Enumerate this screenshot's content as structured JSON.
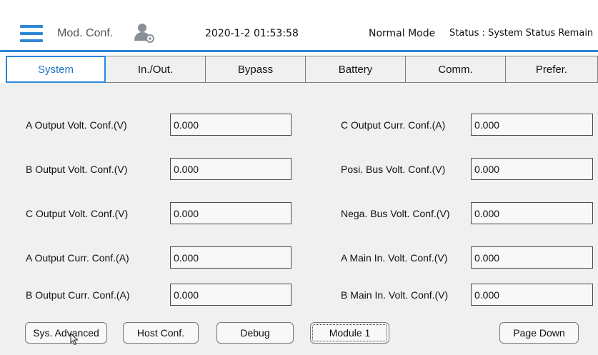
{
  "header": {
    "title": "Mod. Conf.",
    "datetime": "2020-1-2 01:53:58",
    "mode": "Normal Mode",
    "status": "Status : System Status Remain",
    "accent_color": "#2d86d6",
    "menu_icon": "hamburger-menu-icon",
    "user_icon": "user-settings-icon"
  },
  "tabs": [
    {
      "label": "System"
    },
    {
      "label": "In./Out."
    },
    {
      "label": "Bypass"
    },
    {
      "label": "Battery"
    },
    {
      "label": "Comm."
    },
    {
      "label": "Prefer."
    }
  ],
  "fields_left": [
    {
      "label": "A Output Volt. Conf.(V)",
      "value": "0.000"
    },
    {
      "label": "B Output Volt. Conf.(V)",
      "value": "0.000"
    },
    {
      "label": "C Output Volt. Conf.(V)",
      "value": "0.000"
    },
    {
      "label": "A Output Curr. Conf.(A)",
      "value": "0.000"
    },
    {
      "label": "B Output Curr. Conf.(A)",
      "value": "0.000"
    }
  ],
  "fields_right": [
    {
      "label": "C Output Curr. Conf.(A)",
      "value": "0.000"
    },
    {
      "label": "Posi. Bus Volt. Conf.(V)",
      "value": "0.000"
    },
    {
      "label": "Nega. Bus Volt. Conf.(V)",
      "value": "0.000"
    },
    {
      "label": "A Main In. Volt. Conf.(V)",
      "value": "0.000"
    },
    {
      "label": "B Main In. Volt. Conf.(V)",
      "value": "0.000"
    }
  ],
  "buttons": {
    "sys_advanced": "Sys. Advanced",
    "host_conf": "Host Conf.",
    "debug": "Debug",
    "module": "Module 1",
    "page_down": "Page Down"
  }
}
